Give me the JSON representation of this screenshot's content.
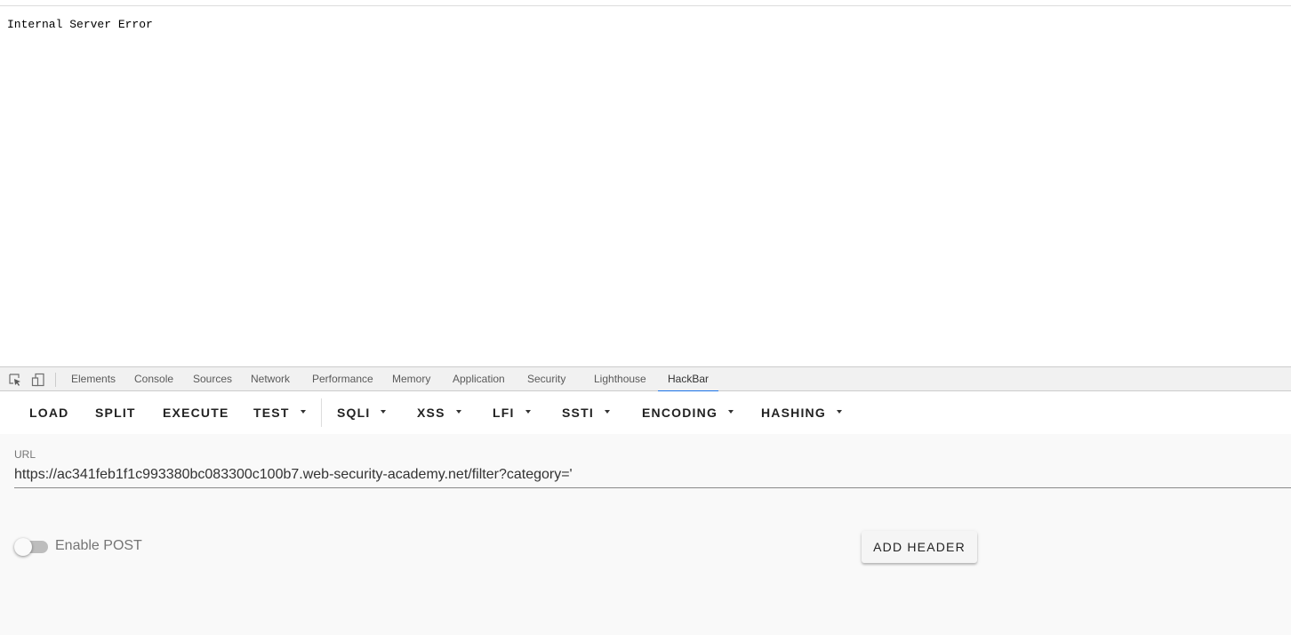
{
  "page": {
    "body_text": "Internal Server Error"
  },
  "devtools": {
    "icons": {
      "inspect": "inspect-element-icon",
      "device": "device-toolbar-icon"
    },
    "tabs": [
      {
        "label": "Elements"
      },
      {
        "label": "Console"
      },
      {
        "label": "Sources"
      },
      {
        "label": "Network"
      },
      {
        "label": "Performance"
      },
      {
        "label": "Memory"
      },
      {
        "label": "Application"
      },
      {
        "label": "Security"
      },
      {
        "label": "Lighthouse"
      },
      {
        "label": "HackBar",
        "active": true
      }
    ],
    "accent_color": "#1a73e8"
  },
  "hackbar": {
    "toolbar": {
      "load": "LOAD",
      "split": "SPLIT",
      "execute": "EXECUTE",
      "test": "TEST",
      "sqli": "SQLI",
      "xss": "XSS",
      "lfi": "LFI",
      "ssti": "SSTI",
      "encoding": "ENCODING",
      "hashing": "HASHING"
    },
    "url_label": "URL",
    "url_value": "https://ac341feb1f1c993380bc083300c100b7.web-security-academy.net/filter?category='",
    "enable_post_label": "Enable POST",
    "enable_post_on": false,
    "add_header_label": "ADD HEADER"
  }
}
